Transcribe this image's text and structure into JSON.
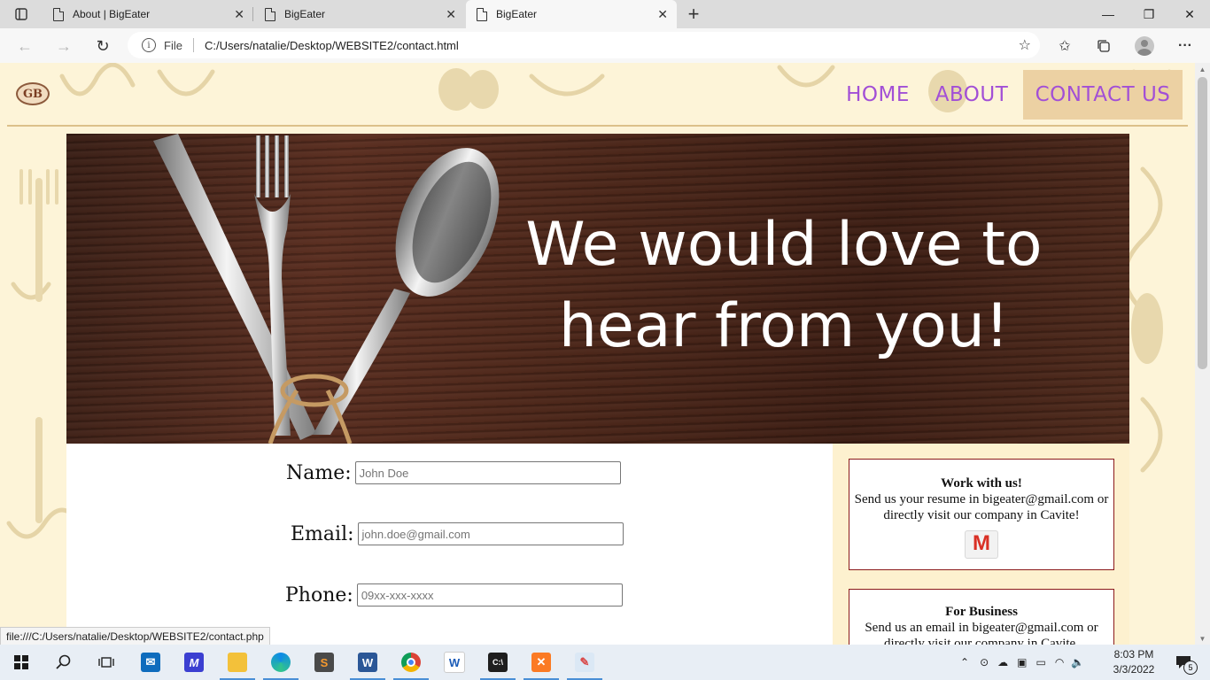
{
  "browser": {
    "tabs": [
      {
        "title": "About | BigEater",
        "active": false
      },
      {
        "title": "BigEater",
        "active": false
      },
      {
        "title": "BigEater",
        "active": true
      }
    ],
    "new_tab_glyph": "+",
    "address": {
      "scheme_label": "File",
      "url": "C:/Users/natalie/Desktop/WEBSITE2/contact.html"
    },
    "window_controls": {
      "minimize": "—",
      "restore": "❐",
      "close": "✕"
    },
    "status_url": "file:///C:/Users/natalie/Desktop/WEBSITE2/contact.php"
  },
  "site": {
    "logo_text": "GB",
    "nav": [
      {
        "label": "HOME",
        "active": false
      },
      {
        "label": "ABOUT",
        "active": false
      },
      {
        "label": "CONTACT US",
        "active": true
      }
    ],
    "banner": {
      "line1": "We would love to",
      "line2": "hear from you!"
    },
    "form": {
      "name_label": "Name:",
      "name_placeholder": "John Doe",
      "email_label": "Email:",
      "email_placeholder": "john.doe@gmail.com",
      "phone_label": "Phone:",
      "phone_placeholder": "09xx-xxx-xxxx"
    },
    "sidebar": {
      "box1": {
        "title": "Work with us!",
        "text": "Send us your resume in bigeater@gmail.com or directly visit our company in Cavite!"
      },
      "box2": {
        "title": "For Business",
        "text": "Send us an email in bigeater@gmail.com or directly visit our company in Cavite."
      }
    }
  },
  "taskbar": {
    "time": "8:03 PM",
    "date": "3/3/2022",
    "notification_count": "5"
  },
  "colors": {
    "nav_text": "#a24fd6",
    "nav_active_bg": "#ecd1a3",
    "page_bg": "#fdf4d8",
    "box_border": "#8b1a1a"
  }
}
